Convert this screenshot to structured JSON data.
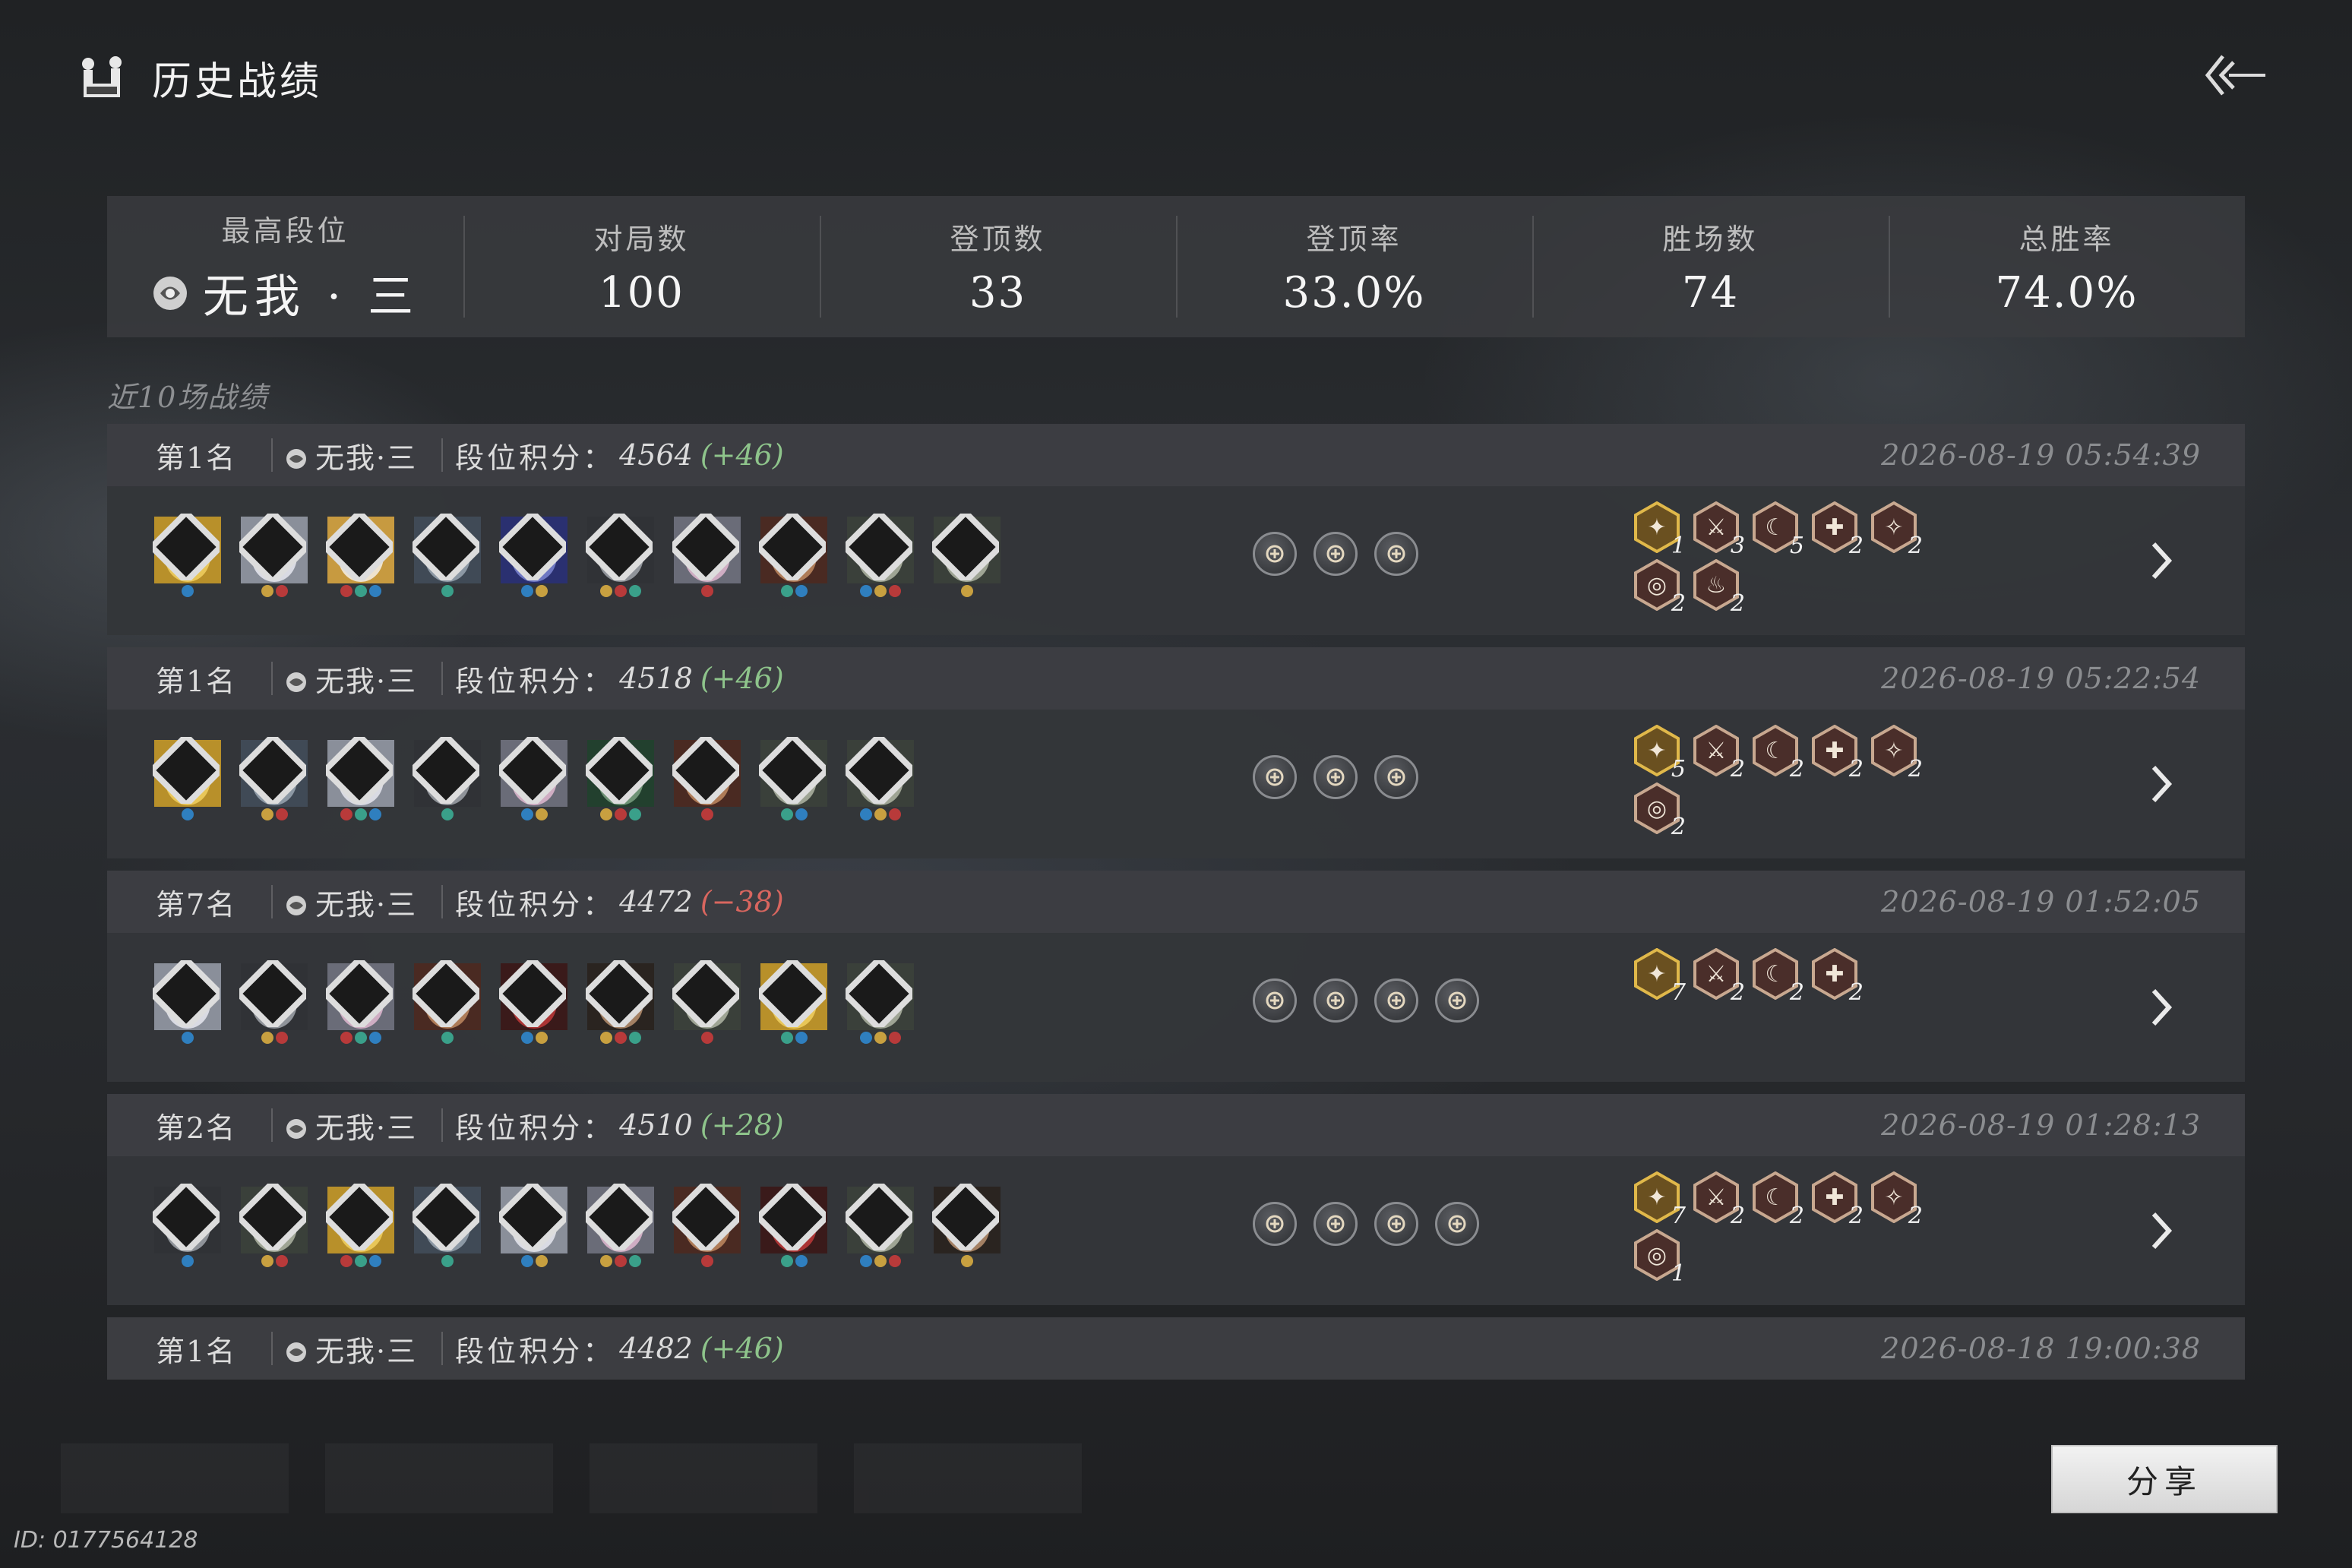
{
  "header": {
    "title": "历史战绩"
  },
  "stats": {
    "highest_rank_label": "最高段位",
    "highest_rank_value": "无我 · 三",
    "matches_label": "对局数",
    "matches_value": "100",
    "tops_label": "登顶数",
    "tops_value": "33",
    "top_rate_label": "登顶率",
    "top_rate_value": "33.0%",
    "wins_label": "胜场数",
    "wins_value": "74",
    "win_rate_label": "总胜率",
    "win_rate_value": "74.0%"
  },
  "recent_title": "近10场战绩",
  "score_label": "段位积分：",
  "matches": [
    {
      "placing": "第1名",
      "tier": "无我·三",
      "score": "4564",
      "delta": "(+46)",
      "delta_sign": "pos",
      "time": "2026-08-19 05:54:39",
      "heroes": [
        "gold",
        "white",
        "goose",
        "grey",
        "blue",
        "armor",
        "pink",
        "warrior",
        "stone",
        "stone"
      ],
      "items": [
        "bag-icon",
        "scroll-icon",
        "coin-icon"
      ],
      "synergies": [
        {
          "n": "1"
        },
        {
          "n": "3"
        },
        {
          "n": "5"
        },
        {
          "n": "2"
        },
        {
          "n": "2"
        },
        {
          "n": "2"
        },
        {
          "n": "2"
        }
      ]
    },
    {
      "placing": "第1名",
      "tier": "无我·三",
      "score": "4518",
      "delta": "(+46)",
      "delta_sign": "pos",
      "time": "2026-08-19 05:22:54",
      "heroes": [
        "gold",
        "grey",
        "white",
        "armor",
        "pink",
        "green",
        "warrior",
        "stone",
        "stone"
      ],
      "items": [
        "swirl-icon",
        "heart-icon",
        "swords-icon"
      ],
      "synergies": [
        {
          "n": "5"
        },
        {
          "n": "2"
        },
        {
          "n": "2"
        },
        {
          "n": "2"
        },
        {
          "n": "2"
        },
        {
          "n": "2"
        }
      ]
    },
    {
      "placing": "第7名",
      "tier": "无我·三",
      "score": "4472",
      "delta": "(−38)",
      "delta_sign": "neg",
      "time": "2026-08-19 01:52:05",
      "heroes": [
        "white",
        "armor",
        "pink",
        "warrior",
        "red",
        "man",
        "stone",
        "gold",
        "stone"
      ],
      "items": [
        "gold-bag-icon",
        "person-icon",
        "refresh-icon",
        "feather-icon"
      ],
      "synergies": [
        {
          "n": "7"
        },
        {
          "n": "2"
        },
        {
          "n": "2"
        },
        {
          "n": "2"
        }
      ]
    },
    {
      "placing": "第2名",
      "tier": "无我·三",
      "score": "4510",
      "delta": "(+28)",
      "delta_sign": "pos",
      "time": "2026-08-19 01:28:13",
      "heroes": [
        "armor",
        "stone",
        "gold",
        "grey",
        "white",
        "pink",
        "warrior",
        "red",
        "stone",
        "man"
      ],
      "items": [
        "gold-bag-icon",
        "person-icon",
        "heart-icon",
        "shield-icon"
      ],
      "synergies": [
        {
          "n": "7"
        },
        {
          "n": "2"
        },
        {
          "n": "2"
        },
        {
          "n": "2"
        },
        {
          "n": "2"
        },
        {
          "n": "1"
        }
      ]
    },
    {
      "placing": "第1名",
      "tier": "无我·三",
      "score": "4482",
      "delta": "(+46)",
      "delta_sign": "pos",
      "time": "2026-08-18 19:00:38"
    }
  ],
  "share_label": "分享",
  "player_id": "ID: 0177564128",
  "colors": {
    "positive": "#8ec48b",
    "negative": "#d9665f",
    "panel": "#3a3c40"
  }
}
